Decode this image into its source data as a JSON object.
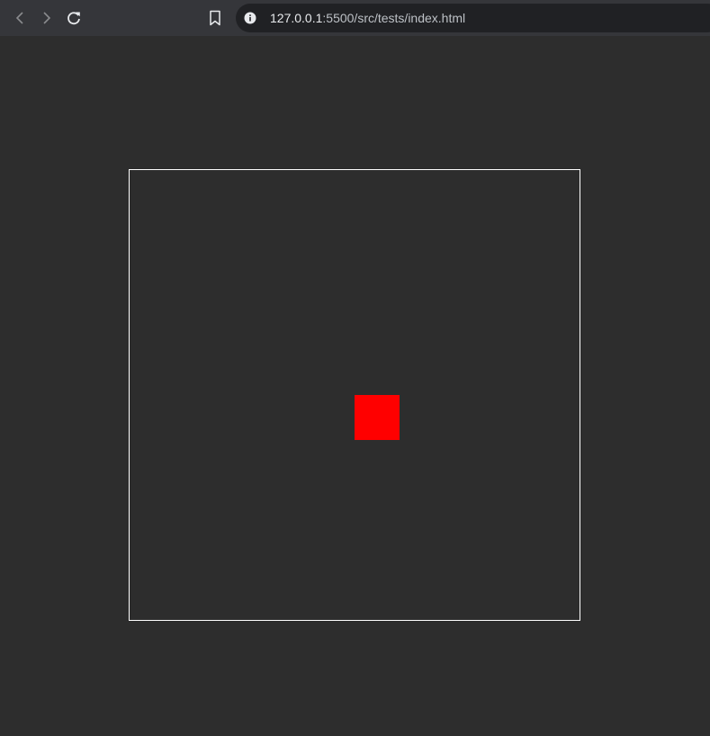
{
  "browser": {
    "url_host": "127.0.0.1",
    "url_rest": ":5500/src/tests/index.html",
    "icons": {
      "back": "chevron-left-icon",
      "forward": "chevron-right-icon",
      "reload": "reload-icon",
      "bookmark": "bookmark-icon",
      "site_info": "info-icon"
    }
  },
  "page": {
    "background_color": "#2d2d2d",
    "stage_border_color": "#ffffff",
    "square_color": "#ff0000"
  }
}
